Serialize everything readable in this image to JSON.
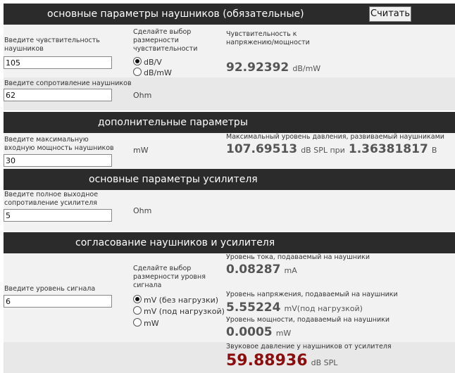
{
  "sections": {
    "main": "основные параметры наушников (обязательные)",
    "extra": "дополнительные параметры",
    "amp": "основные параметры усилителя",
    "match": "согласование наушников и усилителя"
  },
  "calc_button": "Считать",
  "sensitivity": {
    "label": "Введите чувствительность наушников",
    "value": "105",
    "dim_label": "Сделайте выбор размерности чувствительности",
    "options": [
      "dB/V",
      "dB/mW"
    ],
    "selected": 0,
    "result_label": "Чувствительность к напряжению/мощности",
    "result_value": "92.92392",
    "result_unit": "dB/mW"
  },
  "impedance": {
    "label": "Введите сопротивление наушников",
    "value": "62",
    "unit": "Ohm"
  },
  "max_power": {
    "label": "Введите максимальную входную мощность наушников",
    "value": "30",
    "unit": "mW",
    "result_label": "Максимальный уровень давления, развиваемый наушниками",
    "spl_value": "107.69513",
    "spl_unit": "dB SPL при",
    "volt_value": "1.36381817",
    "volt_unit": "В"
  },
  "amp_impedance": {
    "label": "Введите полное выходное сопротивление усилителя",
    "value": "5",
    "unit": "Ohm"
  },
  "signal": {
    "label": "Введите уровень сигнала",
    "value": "6",
    "dim_label": "Сделайте выбор размерности уровня сигнала",
    "options": [
      "mV (без нагрузки)",
      "mV (под нагрузкой)",
      "mW"
    ],
    "selected": 0
  },
  "results": {
    "current_label": "Уровень тока, подаваемый на наушники",
    "current_value": "0.08287",
    "current_unit": "mA",
    "voltage_label": "Уровень напряжения, подаваемый на наушники",
    "voltage_value": "5.55224",
    "voltage_unit": "mV(под нагрузкой)",
    "power_label": "Уровень мощности, подаваемый на наушники",
    "power_value": "0.0005",
    "power_unit": "mW",
    "spl_label": "Звуковое давление у наушников от усилителя",
    "spl_value": "59.88936",
    "spl_unit": "dB SPL"
  },
  "colors": {
    "header_bg": "#2b2b2b",
    "row_bg": "#f2f2f2",
    "alt_row_bg": "#e8e8e8",
    "highlight": "#8b0d0d"
  }
}
